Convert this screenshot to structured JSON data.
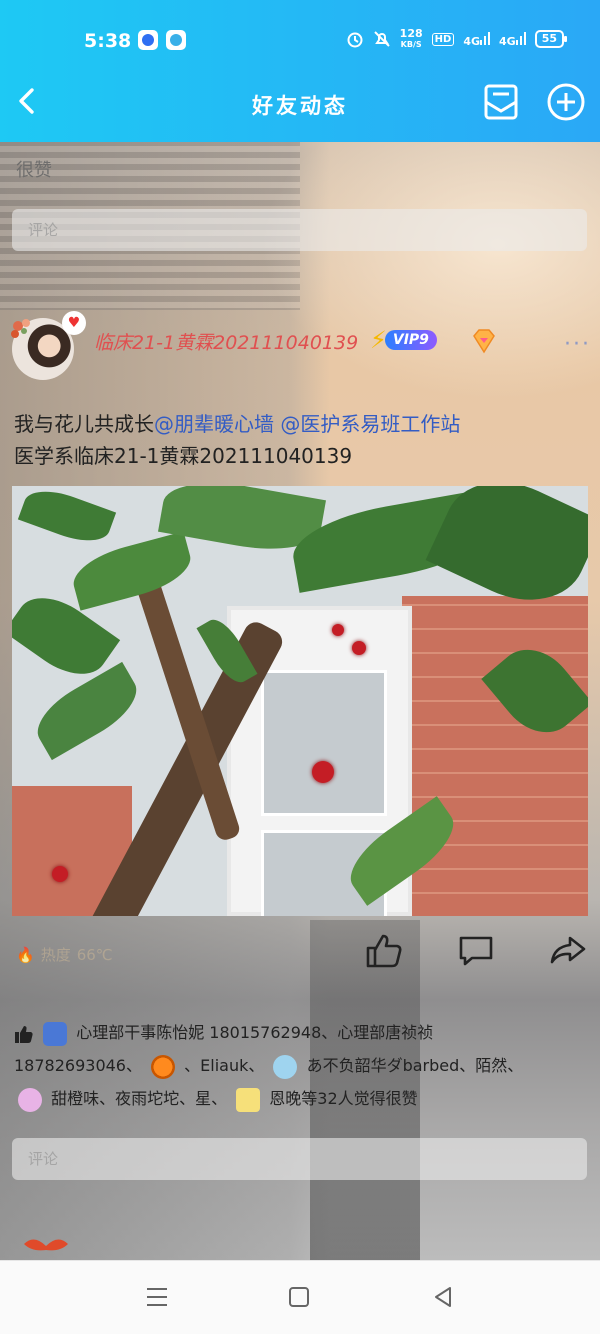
{
  "status_bar": {
    "time": "5:38",
    "net_speed_value": "128",
    "net_speed_unit": "KB/S",
    "hd_label": "HD",
    "net1": "4G",
    "net2": "4G",
    "battery": "55"
  },
  "header": {
    "title": "好友动态",
    "back_icon": "chevron-left-icon",
    "message_icon": "envelope-icon",
    "add_icon": "plus-circle-icon"
  },
  "previous_post": {
    "visible_text_line2": "很赞",
    "comment_placeholder": "评论"
  },
  "post": {
    "username": "临床21-1黄霖202111040139",
    "vip_label": "VIP9",
    "text_plain": "我与花儿共成长",
    "mention1": "@朋辈暖心墙",
    "mention2": "@医护系易班工作站",
    "text_line2": "医学系临床21-1黄霖202111040139",
    "hot_label": "热度",
    "hot_value": "66℃",
    "likes_names_1": "心理部干事陈怡妮 18015762948、心理部唐祯祯",
    "likes_names_2": "18782693046、",
    "likes_names_3": "、Eliauk、",
    "likes_names_4": "あ不负韶华ダbarbed、陌然、",
    "likes_names_5": "甜橙味、夜雨坨坨、星、",
    "likes_names_6": "恩晚等32人觉得很赞",
    "comment_placeholder": "评论"
  },
  "colors": {
    "header_bg": "#1ec9f4",
    "username": "#e05050",
    "mention": "#335cc4"
  }
}
